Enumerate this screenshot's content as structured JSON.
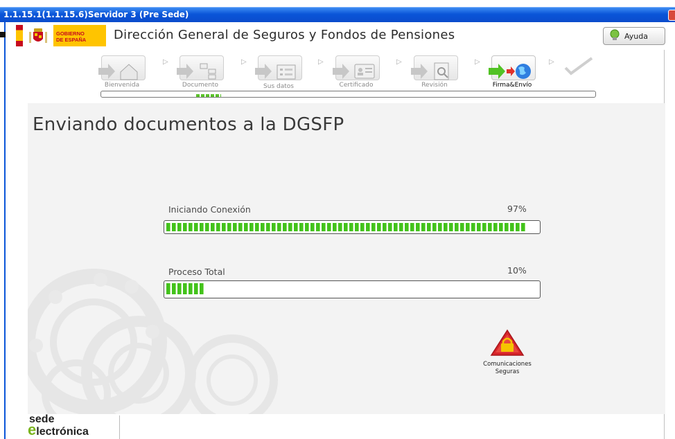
{
  "window": {
    "title": "1.1.15.1(1.1.15.6)Servidor 3 (Pre Sede)"
  },
  "header": {
    "logo_text_1": "GOBIERNO",
    "logo_text_2": "DE ESPAÑA",
    "title": "Dirección General de Seguros y Fondos de Pensiones",
    "help_label": "Ayuda"
  },
  "steps": [
    {
      "label": "Bienvenida",
      "icon": "home-icon"
    },
    {
      "label": "Documento",
      "icon": "document-tree-icon"
    },
    {
      "label": "Sus datos",
      "icon": "form-icon"
    },
    {
      "label": "Certificado",
      "icon": "certificate-icon"
    },
    {
      "label": "Revisión",
      "icon": "magnifier-icon"
    },
    {
      "label": "Firma&Envío",
      "icon": "globe-icon",
      "active": true
    }
  ],
  "finish_icon": "checkmark-icon",
  "main": {
    "title": "Enviando documentos a la DGSFP",
    "progress_connection": {
      "label": "Iniciando Conexión",
      "percent_text": "97%",
      "value": 0.97
    },
    "progress_total": {
      "label": "Proceso Total",
      "percent_text": "10%",
      "value": 0.1
    },
    "secure_line1": "Comunicaciones",
    "secure_line2": "Seguras"
  },
  "footer": {
    "brand_line1": "sede",
    "brand_e": "e",
    "brand_line2": "lectrónica"
  },
  "colors": {
    "title_bar": "#0a55d8",
    "progress_green": "#43c21c",
    "secure_red": "#d8242a",
    "brand_green": "#7ab41e"
  }
}
